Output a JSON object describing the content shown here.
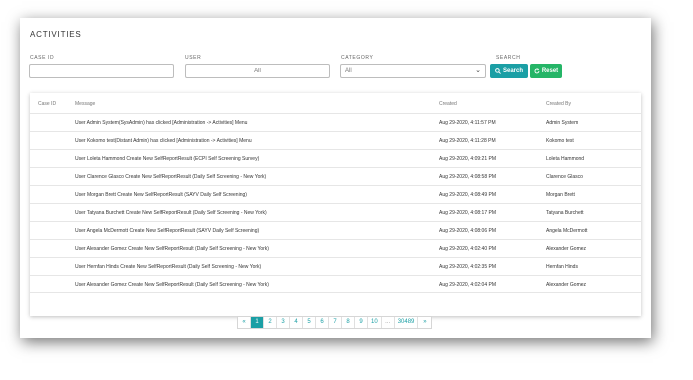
{
  "page": {
    "title": "ACTIVITIES"
  },
  "filters": {
    "case_id": {
      "label": "CASE ID",
      "value": ""
    },
    "user": {
      "label": "USER",
      "placeholder": "All"
    },
    "category": {
      "label": "CATEGORY",
      "value": "All"
    },
    "search": {
      "label": "SEARCH",
      "search_button": "Search",
      "reset_button": "Reset"
    }
  },
  "colors": {
    "search_button": "#1b9fa5",
    "reset_button": "#25b567",
    "active_page": "#1b9fa5"
  },
  "table": {
    "columns": [
      "Case ID",
      "Message",
      "Created",
      "Created By"
    ],
    "rows": [
      {
        "case_id": "",
        "message": "User Admin System(SysAdmin) has clicked [Administration -> Activities] Menu",
        "created": "Aug 29-2020, 4:11:57 PM",
        "created_by": "Admin System"
      },
      {
        "case_id": "",
        "message": "User Kokomo test(Distant Admin) has clicked [Administration -> Activities] Menu",
        "created": "Aug 29-2020, 4:11:28 PM",
        "created_by": "Kokomo test"
      },
      {
        "case_id": "",
        "message": "User Loleta Hammond Create New SelfReportResult (ECPI Self Screening Survey)",
        "created": "Aug 29-2020, 4:09:21 PM",
        "created_by": "Loleta Hammond"
      },
      {
        "case_id": "",
        "message": "User Clarence Glasco Create New SelfReportResult (Daily Self Screening - New York)",
        "created": "Aug 29-2020, 4:08:58 PM",
        "created_by": "Clarence Glasco"
      },
      {
        "case_id": "",
        "message": "User Morgan Brett Create New SelfReportResult (SAYV Daily Self Screening)",
        "created": "Aug 29-2020, 4:08:49 PM",
        "created_by": "Morgan Brett"
      },
      {
        "case_id": "",
        "message": "User Tatyana Burchett Create New SelfReportResult (Daily Self Screening - New York)",
        "created": "Aug 29-2020, 4:08:17 PM",
        "created_by": "Tatyana Burchett"
      },
      {
        "case_id": "",
        "message": "User Angela McDermott Create New SelfReportResult (SAYV Daily Self Screening)",
        "created": "Aug 29-2020, 4:08:06 PM",
        "created_by": "Angela McDermott"
      },
      {
        "case_id": "",
        "message": "User Alexander Gomez Create New SelfReportResult (Daily Self Screening - New York)",
        "created": "Aug 29-2020, 4:02:40 PM",
        "created_by": "Alexander Gomez"
      },
      {
        "case_id": "",
        "message": "User Hernfan Hinds Create New SelfReportResult (Daily Self Screening - New York)",
        "created": "Aug 29-2020, 4:02:35 PM",
        "created_by": "Hernfan Hinds"
      },
      {
        "case_id": "",
        "message": "User Alexander Gomez Create New SelfReportResult (Daily Self Screening - New York)",
        "created": "Aug 29-2020, 4:02:04 PM",
        "created_by": "Alexander Gomez"
      }
    ]
  },
  "pagination": {
    "prev": "«",
    "pages": [
      "1",
      "2",
      "3",
      "4",
      "5",
      "6",
      "7",
      "8",
      "9",
      "10",
      "...",
      "30489"
    ],
    "active": "1",
    "next": "»"
  }
}
